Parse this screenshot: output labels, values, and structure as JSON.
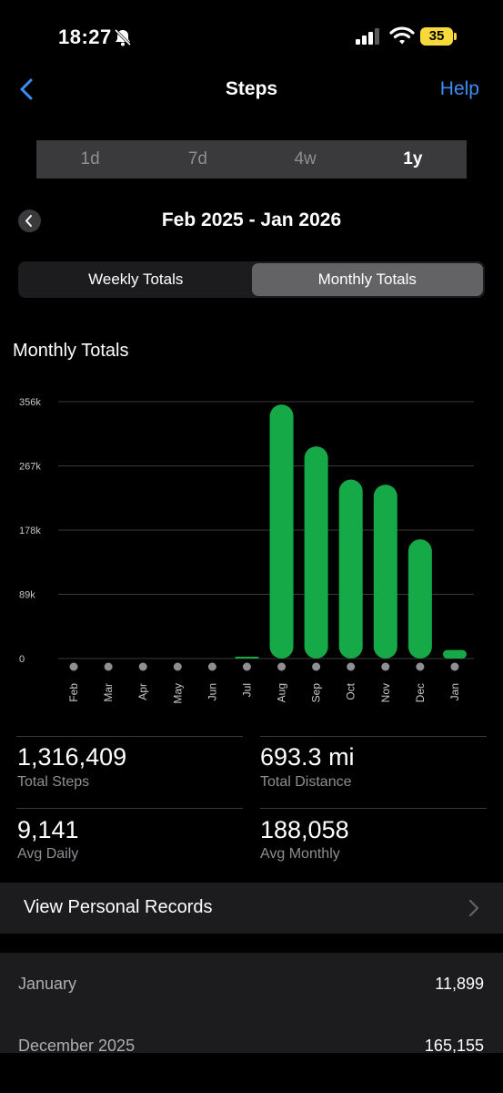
{
  "status_bar": {
    "time": "18:27",
    "battery": "35"
  },
  "nav": {
    "title": "Steps",
    "help": "Help"
  },
  "range_tabs": [
    {
      "label": "1d",
      "active": false
    },
    {
      "label": "7d",
      "active": false
    },
    {
      "label": "4w",
      "active": false
    },
    {
      "label": "1y",
      "active": true
    }
  ],
  "period": "Feb 2025 - Jan 2026",
  "totals_toggle": {
    "weekly": "Weekly Totals",
    "monthly": "Monthly Totals",
    "active": "monthly"
  },
  "chart_title": "Monthly Totals",
  "chart_data": {
    "type": "bar",
    "categories": [
      "Feb",
      "Mar",
      "Apr",
      "May",
      "Jun",
      "Jul",
      "Aug",
      "Sep",
      "Oct",
      "Nov",
      "Dec",
      "Jan"
    ],
    "values": [
      0,
      0,
      0,
      0,
      0,
      2000,
      352000,
      294000,
      248000,
      241000,
      165155,
      11899
    ],
    "yticks": [
      "0",
      "89k",
      "178k",
      "267k",
      "356k"
    ],
    "ytick_values": [
      0,
      89000,
      178000,
      267000,
      356000
    ],
    "ylim": [
      0,
      356000
    ],
    "bar_color": "#16a947",
    "grid": true
  },
  "stats": {
    "total_steps": {
      "value": "1,316,409",
      "label": "Total Steps"
    },
    "total_distance": {
      "value": "693.3 mi",
      "label": "Total Distance"
    },
    "avg_daily": {
      "value": "9,141",
      "label": "Avg Daily"
    },
    "avg_monthly": {
      "value": "188,058",
      "label": "Avg Monthly"
    }
  },
  "records_label": "View Personal Records",
  "monthly_list": [
    {
      "month": "January",
      "steps": "11,899"
    },
    {
      "month": "December 2025",
      "steps": "165,155"
    }
  ],
  "colors": {
    "accent": "#3b8df7",
    "bar": "#16a947",
    "battery": "#f7d93a"
  }
}
